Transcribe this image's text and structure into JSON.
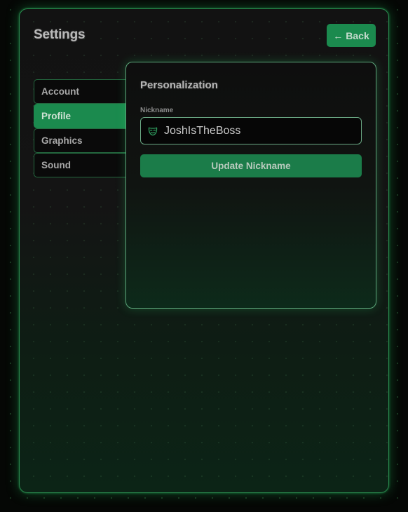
{
  "header": {
    "title": "Settings",
    "back_label": "Back",
    "back_arrow": "←"
  },
  "sidebar": {
    "items": [
      {
        "label": "Account",
        "active": false
      },
      {
        "label": "Profile",
        "active": true
      },
      {
        "label": "Graphics",
        "active": false
      },
      {
        "label": "Sound",
        "active": false
      }
    ]
  },
  "profile": {
    "section_title": "Personalization",
    "nickname_label": "Nickname",
    "nickname_value": "JoshIsTheBoss",
    "nickname_icon": "mask-icon",
    "update_label": "Update Nickname"
  },
  "colors": {
    "accent": "#1b8a4e",
    "border": "#2a8c4f",
    "background": "#050705"
  }
}
